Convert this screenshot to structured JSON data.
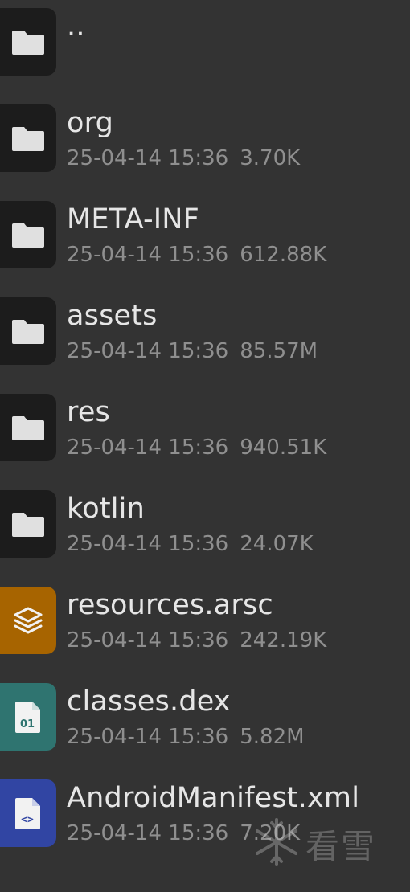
{
  "files": [
    {
      "name": "..",
      "date": "",
      "size": "",
      "icon": "folder-icon",
      "kind": "folder"
    },
    {
      "name": "org",
      "date": "25-04-14 15:36",
      "size": "3.70K",
      "icon": "folder-icon",
      "kind": "folder"
    },
    {
      "name": "META-INF",
      "date": "25-04-14 15:36",
      "size": "612.88K",
      "icon": "folder-icon",
      "kind": "folder"
    },
    {
      "name": "assets",
      "date": "25-04-14 15:36",
      "size": "85.57M",
      "icon": "folder-icon",
      "kind": "folder"
    },
    {
      "name": "res",
      "date": "25-04-14 15:36",
      "size": "940.51K",
      "icon": "folder-icon",
      "kind": "folder"
    },
    {
      "name": "kotlin",
      "date": "25-04-14 15:36",
      "size": "24.07K",
      "icon": "folder-icon",
      "kind": "folder"
    },
    {
      "name": "resources.arsc",
      "date": "25-04-14 15:36",
      "size": "242.19K",
      "icon": "layers-icon",
      "kind": "arsc"
    },
    {
      "name": "classes.dex",
      "date": "25-04-14 15:36",
      "size": "5.82M",
      "icon": "dex-file-icon",
      "kind": "dex",
      "icon_text": "01"
    },
    {
      "name": "AndroidManifest.xml",
      "date": "25-04-14 15:36",
      "size": "7.20K",
      "icon": "code-file-icon",
      "kind": "xml",
      "icon_text": "<>"
    }
  ],
  "watermark": {
    "text": "看雪",
    "icon": "snowflake-icon"
  },
  "colors": {
    "background": "#333333",
    "folder_tile": "#1c1c1c",
    "arsc_tile": "#a76400",
    "dex_tile": "#2f7470",
    "xml_tile": "#3145a3",
    "name_text": "#e6e6e6",
    "meta_text": "#8f8f8f"
  }
}
